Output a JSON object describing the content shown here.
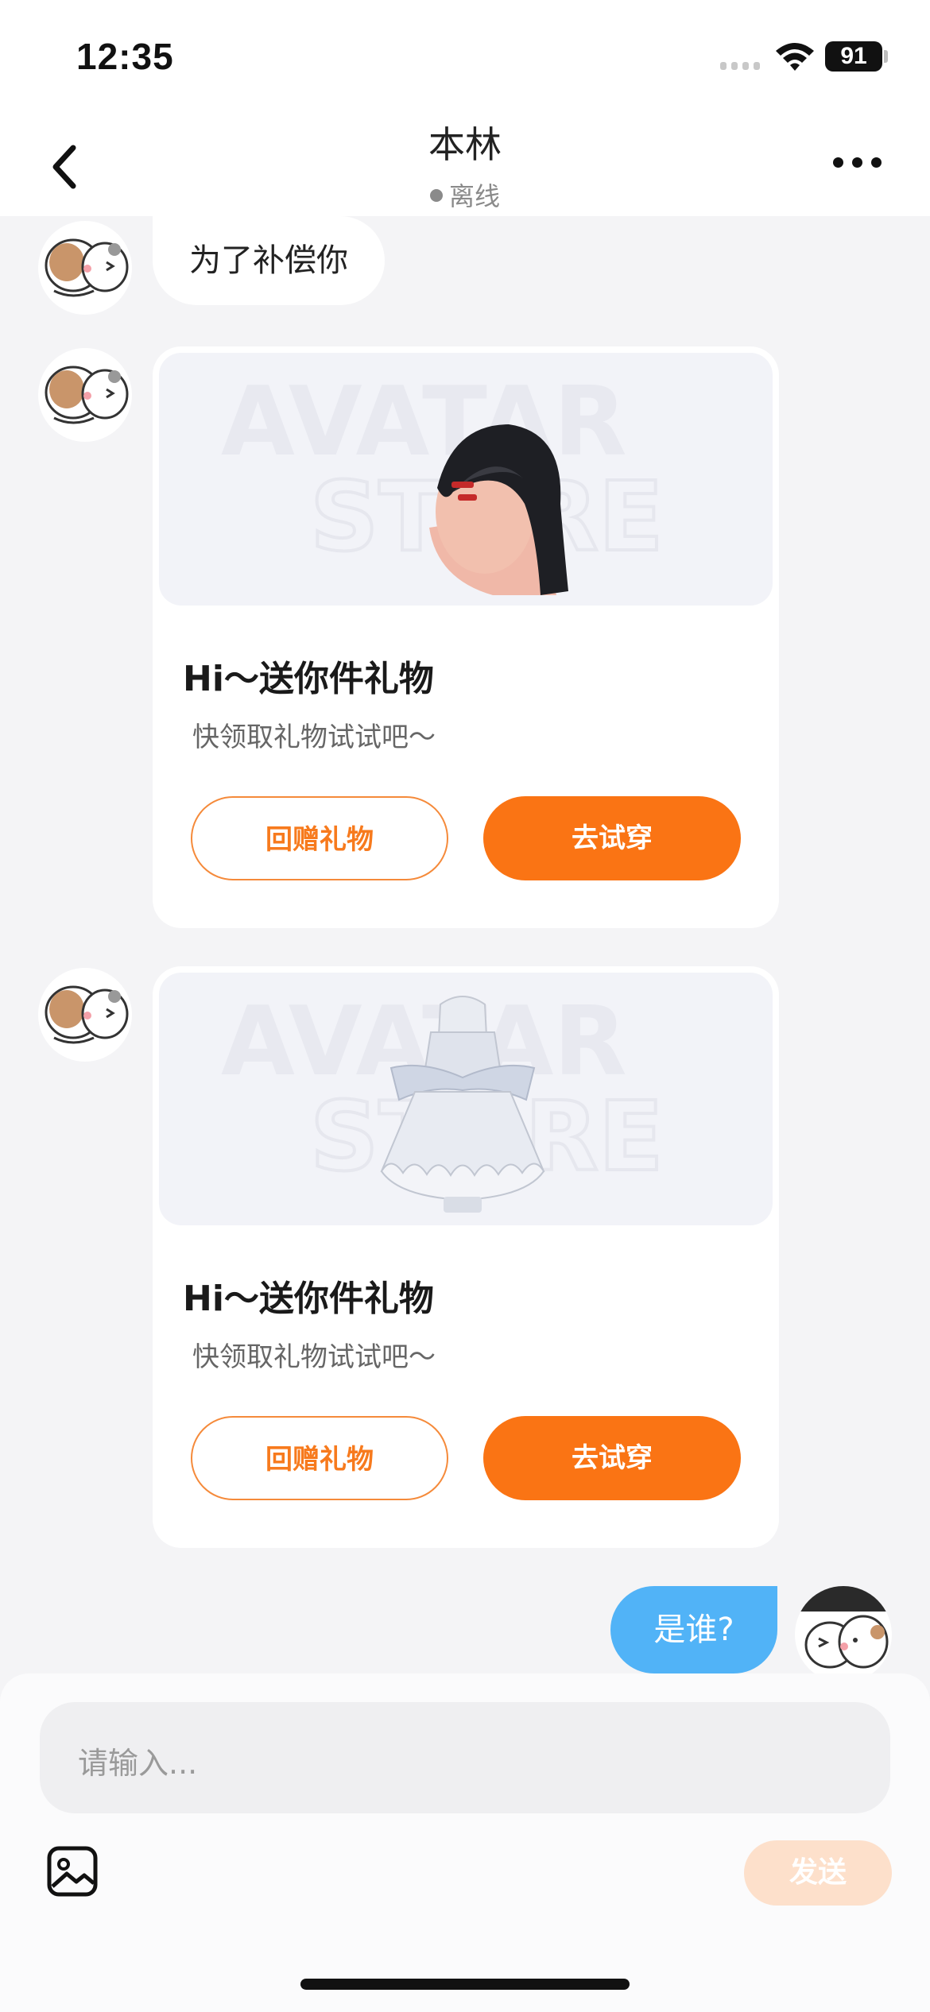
{
  "status_bar": {
    "time": "12:35",
    "battery": "91"
  },
  "header": {
    "title": "本林",
    "status": "离线"
  },
  "messages": {
    "text_in": "为了补偿你",
    "gift_cards": [
      {
        "title": "Hi～送你件礼物",
        "subtitle": "快领取礼物试试吧～",
        "return_gift": "回赠礼物",
        "try_on": "去试穿",
        "item": "hair-item-image"
      },
      {
        "title": "Hi～送你件礼物",
        "subtitle": "快领取礼物试试吧～",
        "return_gift": "回赠礼物",
        "try_on": "去试穿",
        "item": "dress-item-image"
      }
    ],
    "text_out": "是谁?"
  },
  "composer": {
    "placeholder": "请输入...",
    "send": "发送"
  },
  "colors": {
    "accent": "#fa7414",
    "outgoing_bubble": "#51b3f7",
    "send_disabled": "#fde0cb"
  }
}
